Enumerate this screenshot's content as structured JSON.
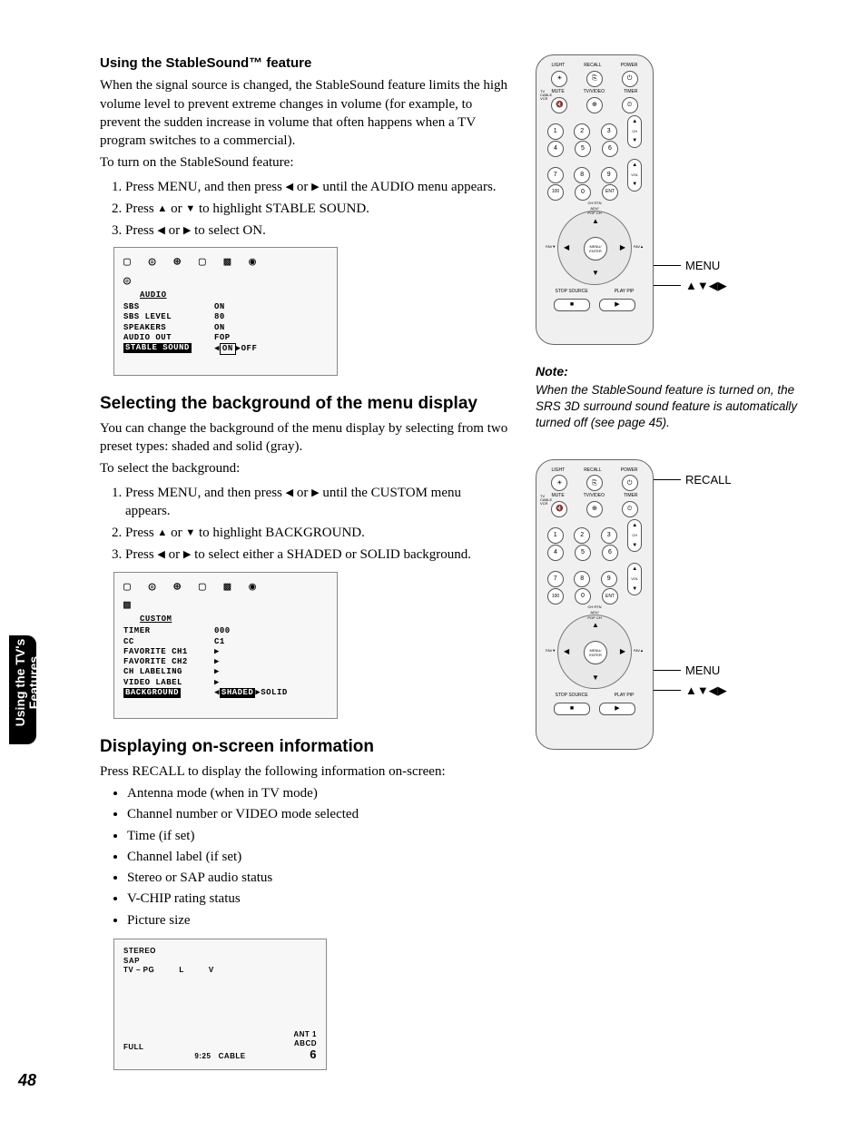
{
  "tab": {
    "line1": "Using the TV's",
    "line2": "Features"
  },
  "page_number": "48",
  "section1": {
    "heading": "Using the StableSound™ feature",
    "para1": "When the signal source is changed, the StableSound feature limits the high volume level to prevent extreme changes in volume (for example, to prevent the sudden increase in volume that often happens when a TV program switches to a commercial).",
    "para2": "To turn on the StableSound feature:",
    "step1a": "Press MENU, and then press ",
    "step1b": " or ",
    "step1c": " until the AUDIO menu appears.",
    "step2a": "Press ",
    "step2b": " or ",
    "step2c": " to highlight STABLE SOUND.",
    "step3a": "Press ",
    "step3b": " or ",
    "step3c": " to select ON."
  },
  "osd1": {
    "title": "AUDIO",
    "rows": [
      {
        "l": "SBS",
        "r": "ON"
      },
      {
        "l": "SBS LEVEL",
        "r": "80"
      },
      {
        "l": "SPEAKERS",
        "r": "ON"
      },
      {
        "l": "AUDIO OUT",
        "r": "FOP"
      }
    ],
    "hl_l": "STABLE SOUND",
    "hl_r_on": "ON",
    "hl_r_off": "OFF"
  },
  "section2": {
    "heading": "Selecting the background of the menu display",
    "para1": "You can change the background of the menu display by selecting from two preset types: shaded and solid (gray).",
    "para2": "To select the background:",
    "step1a": "Press MENU, and then press ",
    "step1b": " or ",
    "step1c": " until the CUSTOM menu appears.",
    "step2a": "Press ",
    "step2b": " or ",
    "step2c": " to highlight BACKGROUND.",
    "step3a": "Press ",
    "step3b": " or ",
    "step3c": " to select either a SHADED or SOLID background."
  },
  "osd2": {
    "title": "CUSTOM",
    "rows": [
      {
        "l": "TIMER",
        "r": "000"
      },
      {
        "l": "CC",
        "r": "C1"
      },
      {
        "l": "FAVORITE CH1",
        "r": "▶"
      },
      {
        "l": "FAVORITE CH2",
        "r": "▶"
      },
      {
        "l": "CH LABELING",
        "r": "▶"
      },
      {
        "l": "VIDEO LABEL",
        "r": "▶"
      }
    ],
    "hl_l": "BACKGROUND",
    "hl_r1": "SHADED",
    "hl_r2": "SOLID"
  },
  "section3": {
    "heading": "Displaying on-screen information",
    "para1": "Press RECALL to display the following information on-screen:",
    "bullets": [
      "Antenna mode (when in TV mode)",
      "Channel number or VIDEO mode selected",
      "Time (if set)",
      "Channel label (if set)",
      "Stereo or SAP audio status",
      "V-CHIP rating status",
      "Picture size"
    ]
  },
  "osd3": {
    "tl1": "STEREO",
    "tl2": "SAP",
    "tl3": "TV – PG",
    "tc1": "L",
    "tc2": "V",
    "bl": "FULL",
    "br1": "ANT   1",
    "br2": "ABCD",
    "br3": "6",
    "bc1": "9:25",
    "bc2": "CABLE"
  },
  "remote": {
    "top_labels": [
      "LIGHT",
      "RECALL",
      "POWER"
    ],
    "second_labels": [
      "MUTE",
      "TV/VIDEO",
      "TIMER"
    ],
    "switch": [
      "TV",
      "CABLE",
      "VCR"
    ],
    "ch": "CH",
    "vol": "VOL",
    "chrtn": "CH RTN",
    "ent": "ENT",
    "hundred": "100",
    "menu_enter": "MENU/\nENTER",
    "adv_pop": "ADV/\nPOP CH",
    "favl": "FAV▼",
    "favr": "FAV▲",
    "bottom_l": "STOP SOURCE",
    "bottom_r": "PLAY PIP"
  },
  "callouts": {
    "menu": "MENU",
    "arrows": "▲▼◀▶",
    "recall": "RECALL"
  },
  "note": {
    "heading": "Note:",
    "body": "When the StableSound feature is turned on, the SRS 3D surround sound feature is automatically turned off (see page 45)."
  }
}
